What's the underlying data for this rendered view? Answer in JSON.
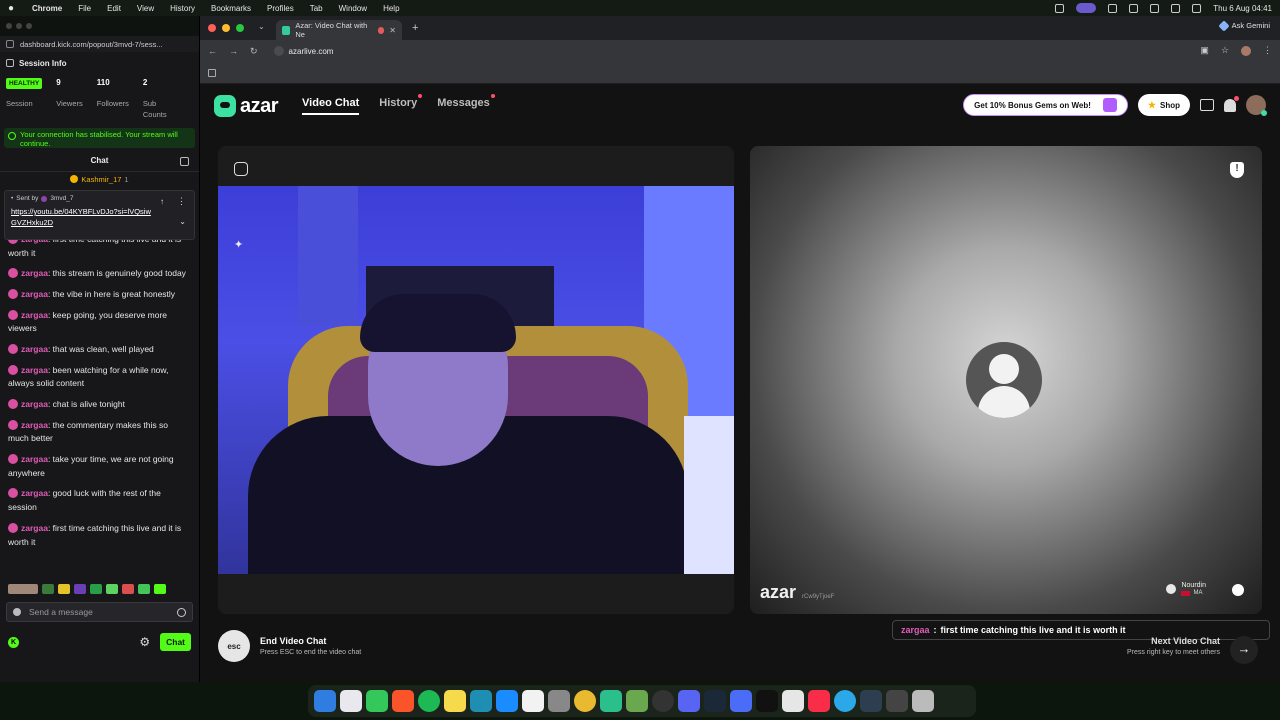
{
  "menubar": {
    "app": "Chrome",
    "items": [
      "File",
      "Edit",
      "View",
      "History",
      "Bookmarks",
      "Profiles",
      "Tab",
      "Window",
      "Help"
    ],
    "datetime": "Thu 6 Aug 04:41"
  },
  "popout": {
    "url": "dashboard.kick.com/popout/3mvd-7/sess...",
    "session_title": "Session Info",
    "stats": [
      {
        "value": "HEALTHY",
        "label": "Session",
        "badge": true
      },
      {
        "value": "9",
        "label": "Viewers"
      },
      {
        "value": "110",
        "label": "Followers"
      },
      {
        "value": "2",
        "label": "Sub Counts"
      }
    ],
    "alert": "Your connection has stabilised. Your stream will continue.",
    "chat_title": "Chat",
    "top_gifter": {
      "name": "Kashmir_17",
      "count": "1"
    },
    "pinned": {
      "sent_by_label": "Sent by",
      "sender": "3mvd_7",
      "link": "https://youtu.be/04KYBFLvDJo?si=lVQsiwGVZHxku2D"
    },
    "messages": [
      {
        "user": "zargaa",
        "text": "first time catching this live and it is worth it",
        "partial": true
      },
      {
        "user": "zargaa",
        "text": "this stream is genuinely good today"
      },
      {
        "user": "zargaa",
        "text": "the vibe in here is great honestly"
      },
      {
        "user": "zargaa",
        "text": "keep going, you deserve more viewers"
      },
      {
        "user": "zargaa",
        "text": "that was clean, well played"
      },
      {
        "user": "zargaa",
        "text": "been watching for a while now, always solid content"
      },
      {
        "user": "zargaa",
        "text": "chat is alive tonight"
      },
      {
        "user": "zargaa",
        "text": "the commentary makes this so much better"
      },
      {
        "user": "zargaa",
        "text": "take your time, we are not going anywhere"
      },
      {
        "user": "zargaa",
        "text": "good luck with the rest of the session"
      },
      {
        "user": "zargaa",
        "text": "first time catching this live and it is worth it"
      }
    ],
    "send_placeholder": "Send a message",
    "chat_button": "Chat",
    "accent": "#53fc18"
  },
  "chrome": {
    "tab_title": "Azar: Video Chat with Ne",
    "address": "azarlive.com",
    "ask_gemini": "Ask Gemini"
  },
  "azar": {
    "logo": "azar",
    "nav": [
      "Video Chat",
      "History",
      "Messages"
    ],
    "gems_button": "Get 10% Bonus Gems on Web!",
    "shop_button": "Shop",
    "watermark": "azar",
    "watermark_code": "rCw9yTjoeF",
    "partner_name": "Nourdin",
    "partner_country": "MA",
    "end_title": "End Video Chat",
    "end_subtitle": "Press ESC to end the video chat",
    "esc_label": "esc",
    "next_title": "Next Video Chat",
    "next_subtitle": "Press right key to meet others",
    "overlay": {
      "user": "zargaa",
      "separator": ":",
      "text": "first time catching this live and it is worth it"
    },
    "accent": "#3de0a1"
  }
}
